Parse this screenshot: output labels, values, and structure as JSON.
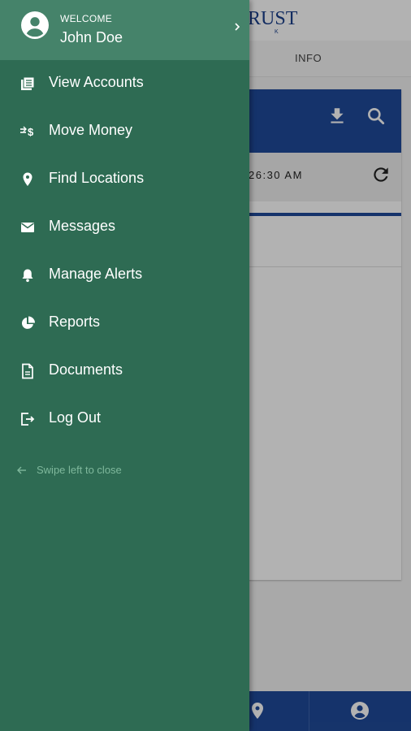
{
  "app": {
    "brand": "RUST",
    "brand_sub": "K",
    "tab_info": "INFO",
    "time_text": "26:30 AM"
  },
  "drawer": {
    "welcome": "WELCOME",
    "user_name": "John Doe",
    "items": [
      {
        "label": "View Accounts",
        "icon": "accounts-icon"
      },
      {
        "label": "Move Money",
        "icon": "move-money-icon"
      },
      {
        "label": "Find Locations",
        "icon": "location-pin-icon"
      },
      {
        "label": "Messages",
        "icon": "mail-icon"
      },
      {
        "label": "Manage Alerts",
        "icon": "bell-icon"
      },
      {
        "label": "Reports",
        "icon": "pie-chart-icon"
      },
      {
        "label": "Documents",
        "icon": "document-icon"
      },
      {
        "label": "Log Out",
        "icon": "logout-icon"
      }
    ],
    "swipe_hint": "Swipe left to close"
  },
  "colors": {
    "drawer_bg": "#2e6b53",
    "drawer_header_bg": "#45836a",
    "app_blue": "#1f4a9a",
    "hint_text": "#7fb89c"
  }
}
